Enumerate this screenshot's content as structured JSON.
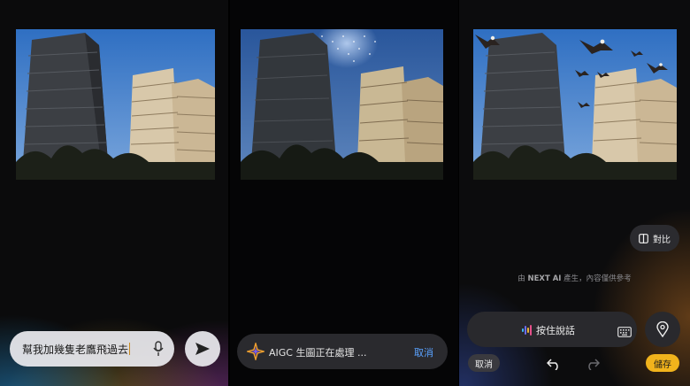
{
  "panels": {
    "left": {
      "prompt": {
        "value": "幫我加幾隻老鷹飛過去"
      },
      "icons": {
        "mic": "microphone-icon",
        "send": "send-arrow-icon"
      }
    },
    "middle": {
      "status_text": "AIGC 生圖正在處理 ...",
      "cancel_label": "取消",
      "icons": {
        "status": "aigc-sparkle-icon"
      }
    },
    "right": {
      "compare_label": "對比",
      "ai_note_brand": "NEXT AI",
      "ai_note_prefix": "由 ",
      "ai_note_suffix": " 產生，內容僅供參考",
      "talk_label": "按住說話",
      "cancel_label": "取消",
      "save_label": "儲存",
      "icons": {
        "compare": "compare-icon",
        "voice": "voice-wave-icon",
        "keyboard": "keyboard-icon",
        "location": "location-pin-icon",
        "undo": "undo-icon",
        "redo": "redo-icon"
      }
    }
  },
  "colors": {
    "accent_save": "#f1b31c",
    "cancel_link": "#5aa2ff",
    "pill_dark": "#29292d"
  }
}
